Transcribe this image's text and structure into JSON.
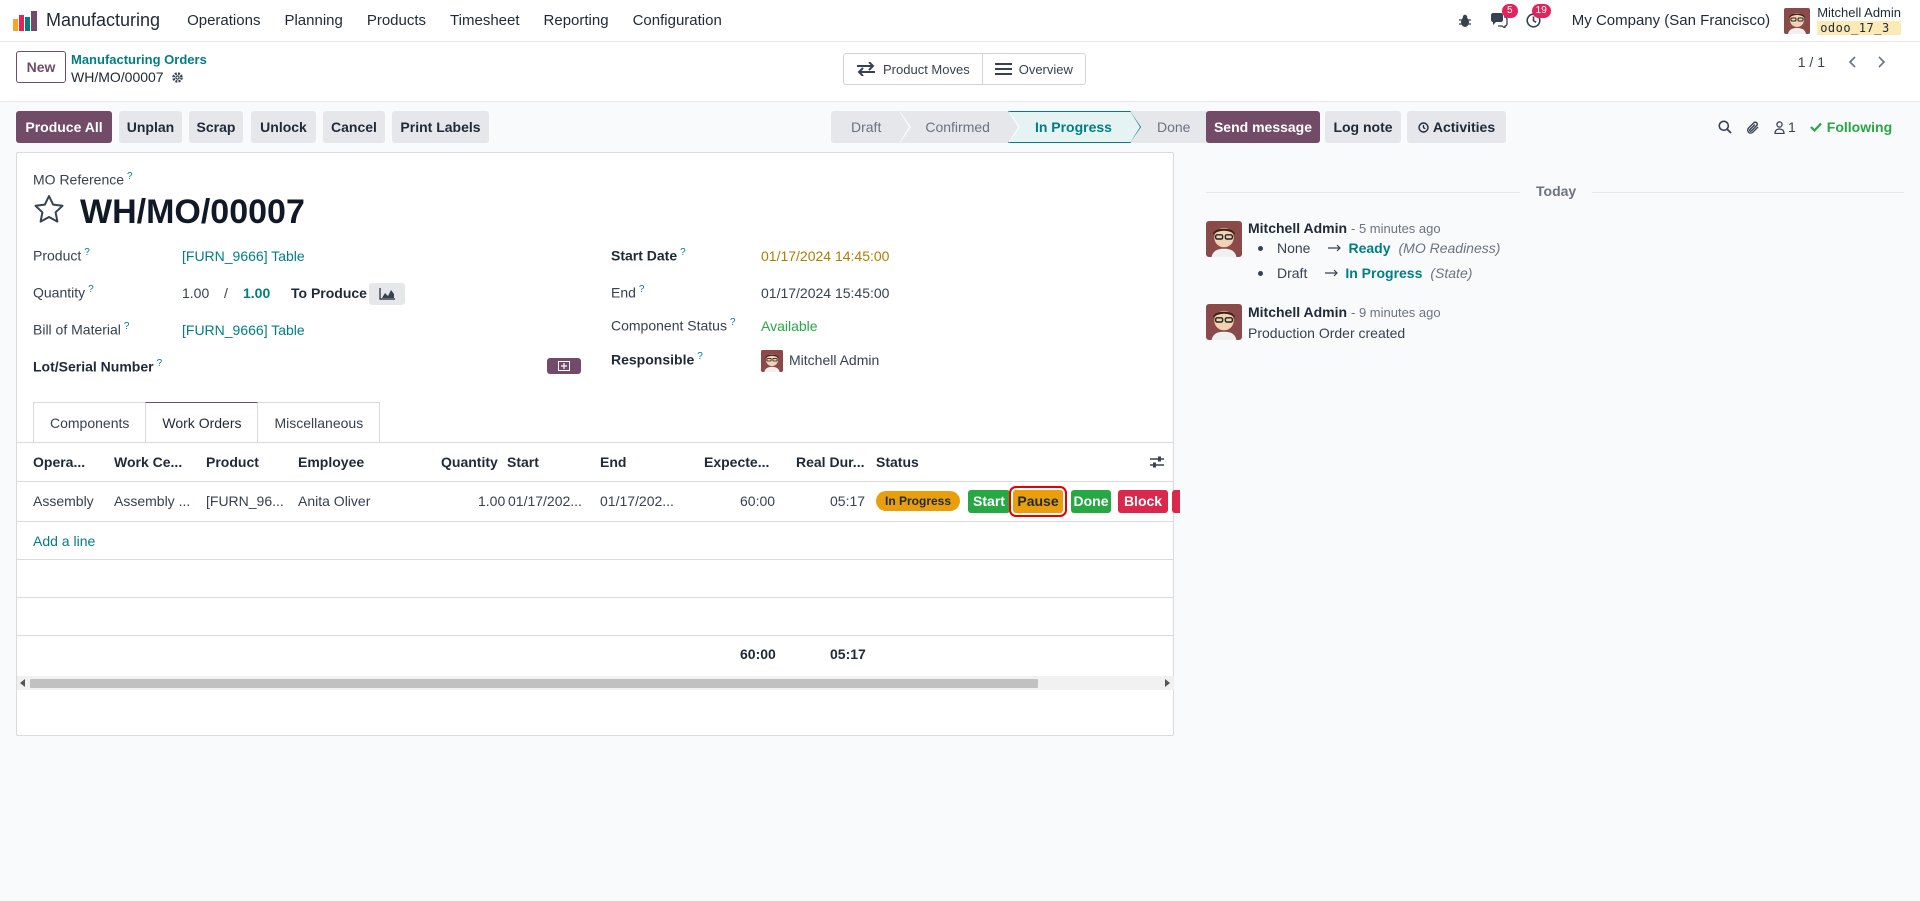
{
  "navbar": {
    "app_name": "Manufacturing",
    "menu": [
      "Operations",
      "Planning",
      "Products",
      "Timesheet",
      "Reporting",
      "Configuration"
    ],
    "messages_badge": "5",
    "activities_badge": "19",
    "company": "My Company (San Francisco)",
    "user_name": "Mitchell Admin",
    "db_name": "odoo_17_3"
  },
  "control": {
    "new_label": "New",
    "breadcrumb_parent": "Manufacturing Orders",
    "breadcrumb_current": "WH/MO/00007",
    "smart_buttons": [
      "Product Moves",
      "Overview"
    ],
    "pager": "1 / 1"
  },
  "actions": {
    "produce_all": "Produce All",
    "unplan": "Unplan",
    "scrap": "Scrap",
    "unlock": "Unlock",
    "cancel": "Cancel",
    "print_labels": "Print Labels"
  },
  "statusbar": {
    "stages": [
      "Draft",
      "Confirmed",
      "In Progress",
      "Done"
    ],
    "active": "In Progress"
  },
  "form": {
    "mo_reference_label": "MO Reference",
    "mo_reference": "WH/MO/00007",
    "product_label": "Product",
    "product": "[FURN_9666] Table",
    "quantity_label": "Quantity",
    "quantity": "1.00",
    "quantity_sep": "/",
    "quantity_target": "1.00",
    "to_produce": "To Produce",
    "bom_label": "Bill of Material",
    "bom": "[FURN_9666] Table",
    "lot_label": "Lot/Serial Number",
    "start_date_label": "Start Date",
    "start_date": "01/17/2024 14:45:00",
    "end_label": "End",
    "end": "01/17/2024 15:45:00",
    "component_status_label": "Component Status",
    "component_status": "Available",
    "responsible_label": "Responsible",
    "responsible": "Mitchell Admin"
  },
  "tabs": [
    "Components",
    "Work Orders",
    "Miscellaneous"
  ],
  "work_orders": {
    "columns": [
      "Opera...",
      "Work Ce...",
      "Product",
      "Employee",
      "Quantity",
      "Start",
      "End",
      "Expecte...",
      "Real Dur...",
      "Status"
    ],
    "row": {
      "operation": "Assembly",
      "work_center": "Assembly ...",
      "product": "[FURN_96...",
      "employee": "Anita Oliver",
      "quantity": "1.00",
      "start": "01/17/202...",
      "end": "01/17/202...",
      "expected": "60:00",
      "real_duration": "05:17",
      "status": "In Progress"
    },
    "buttons": {
      "start": "Start",
      "pause": "Pause",
      "done": "Done",
      "block": "Block"
    },
    "add_line": "Add a line",
    "total_expected": "60:00",
    "total_real": "05:17"
  },
  "chatter": {
    "send_message": "Send message",
    "log_note": "Log note",
    "activities": "Activities",
    "followers_count": "1",
    "following": "Following",
    "today": "Today",
    "messages": [
      {
        "author": "Mitchell Admin",
        "time": "- 5 minutes ago",
        "changes": [
          {
            "from": "None",
            "to": "Ready",
            "field": "(MO Readiness)"
          },
          {
            "from": "Draft",
            "to": "In Progress",
            "field": "(State)"
          }
        ]
      },
      {
        "author": "Mitchell Admin",
        "time": "- 9 minutes ago",
        "body": "Production Order created"
      }
    ]
  },
  "colors": {
    "brand": "#714b67",
    "link": "#017e84",
    "in_progress": "#e89f0b",
    "success": "#28a745",
    "danger": "#d9284c"
  }
}
